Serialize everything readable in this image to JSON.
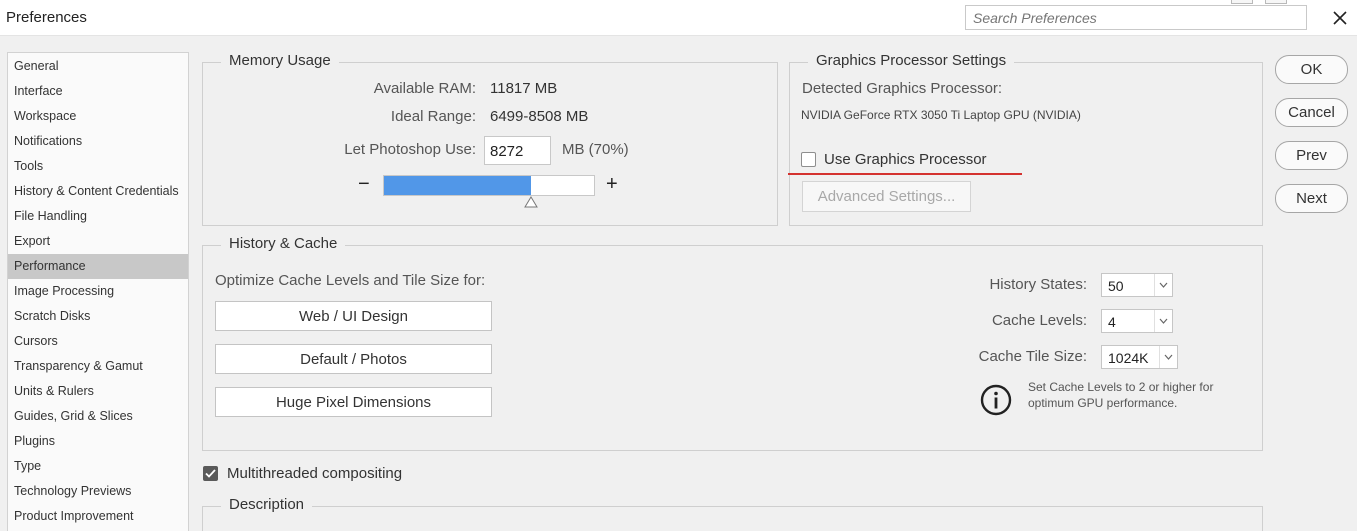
{
  "window": {
    "title": "Preferences"
  },
  "search": {
    "placeholder": "Search Preferences"
  },
  "sidebar": {
    "items": [
      {
        "label": "General"
      },
      {
        "label": "Interface"
      },
      {
        "label": "Workspace"
      },
      {
        "label": "Notifications"
      },
      {
        "label": "Tools"
      },
      {
        "label": "History & Content Credentials"
      },
      {
        "label": "File Handling"
      },
      {
        "label": "Export"
      },
      {
        "label": "Performance",
        "selected": true
      },
      {
        "label": "Image Processing"
      },
      {
        "label": "Scratch Disks"
      },
      {
        "label": "Cursors"
      },
      {
        "label": "Transparency & Gamut"
      },
      {
        "label": "Units & Rulers"
      },
      {
        "label": "Guides, Grid & Slices"
      },
      {
        "label": "Plugins"
      },
      {
        "label": "Type"
      },
      {
        "label": "Technology Previews"
      },
      {
        "label": "Product Improvement"
      }
    ]
  },
  "memory": {
    "title": "Memory Usage",
    "available_label": "Available RAM:",
    "available_value": "11817 MB",
    "ideal_label": "Ideal Range:",
    "ideal_value": "6499-8508 MB",
    "let_label": "Let Photoshop Use:",
    "let_value": "8272",
    "let_suffix": "MB (70%)",
    "slider_fraction": 0.7,
    "minus": "−",
    "plus": "+"
  },
  "gpu": {
    "title": "Graphics Processor Settings",
    "detected_label": "Detected Graphics Processor:",
    "detected_value": "NVIDIA GeForce RTX 3050 Ti Laptop GPU (NVIDIA)",
    "use_label": "Use Graphics Processor",
    "use_checked": false,
    "advanced_label": "Advanced Settings..."
  },
  "history": {
    "title": "History & Cache",
    "optimize_label": "Optimize Cache Levels and Tile Size for:",
    "presets": [
      "Web / UI Design",
      "Default / Photos",
      "Huge Pixel Dimensions"
    ],
    "states_label": "History States:",
    "states_value": "50",
    "levels_label": "Cache Levels:",
    "levels_value": "4",
    "tile_label": "Cache Tile Size:",
    "tile_value": "1024K",
    "info_line1": "Set Cache Levels to 2 or higher for",
    "info_line2": "optimum GPU performance."
  },
  "multithreaded": {
    "label": "Multithreaded compositing",
    "checked": true
  },
  "description": {
    "title": "Description"
  },
  "buttons": {
    "ok": "OK",
    "cancel": "Cancel",
    "prev": "Prev",
    "next": "Next"
  },
  "colors": {
    "accent": "#5197e8",
    "highlight_line": "#d4322f",
    "selected_item": "#c8c8c8"
  }
}
